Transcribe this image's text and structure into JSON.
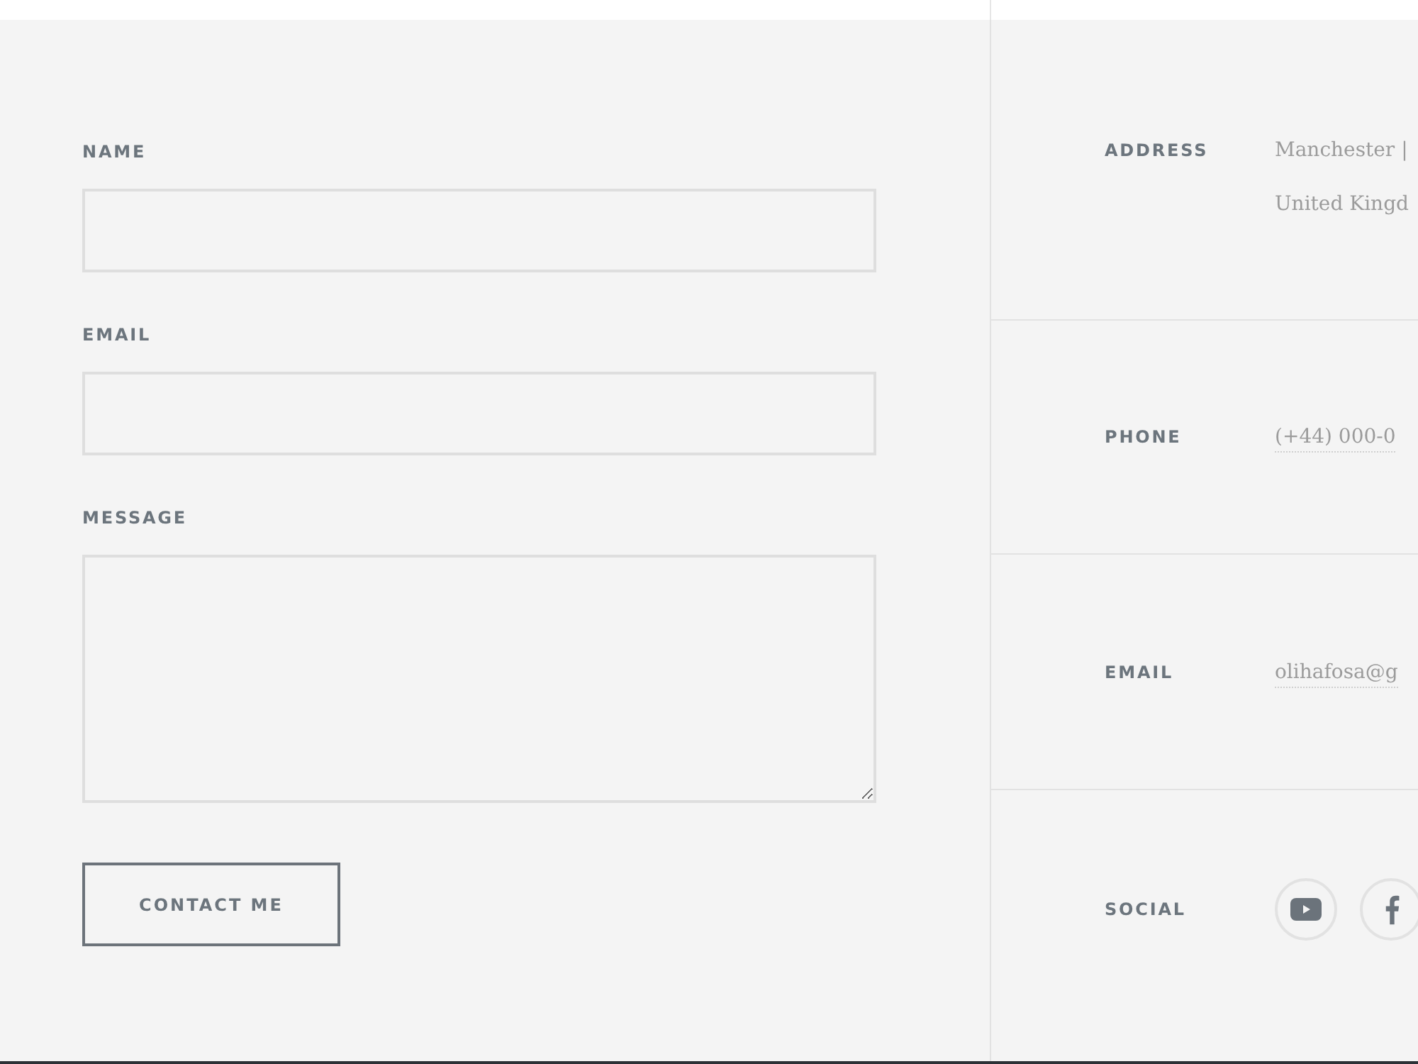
{
  "form": {
    "fields": [
      {
        "kind": "input",
        "label": "NAME"
      },
      {
        "kind": "input",
        "label": "EMAIL"
      },
      {
        "kind": "textarea",
        "label": "MESSAGE"
      }
    ],
    "submit": {
      "label": "CONTACT ME"
    }
  },
  "contact_info": [
    {
      "kind": "text",
      "label": "ADDRESS",
      "lines": [
        "Manchester |",
        "United Kingd"
      ]
    },
    {
      "kind": "link",
      "label": "PHONE",
      "lines": [
        "(+44) 000-0"
      ]
    },
    {
      "kind": "link",
      "label": "EMAIL",
      "lines": [
        "olihafosa@g"
      ]
    },
    {
      "kind": "social",
      "label": "SOCIAL",
      "icons": [
        {
          "kind": "youtube"
        },
        {
          "kind": "facebook"
        }
      ]
    }
  ]
}
